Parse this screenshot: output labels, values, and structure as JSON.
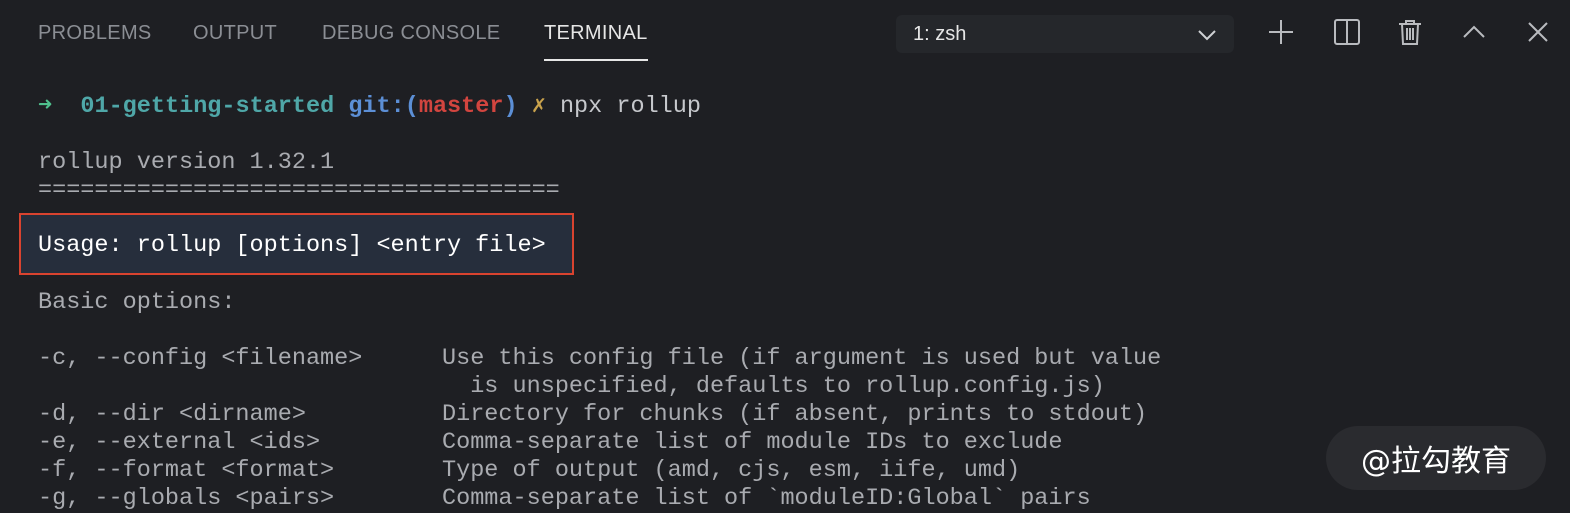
{
  "panel": {
    "tabs": [
      {
        "label": "PROBLEMS",
        "active": false
      },
      {
        "label": "OUTPUT",
        "active": false
      },
      {
        "label": "DEBUG CONSOLE",
        "active": false
      },
      {
        "label": "TERMINAL",
        "active": true
      }
    ],
    "shell_select": {
      "value": "1: zsh"
    },
    "toolbar_icons": [
      "plus-icon",
      "split-icon",
      "trash-icon",
      "chevron-up-icon",
      "close-icon"
    ]
  },
  "terminal": {
    "prompt": {
      "arrow": "➜",
      "dir": "01-getting-started",
      "git_label": "git:(",
      "branch": "master",
      "git_close": ")",
      "dirty_mark": "✗",
      "command": "npx rollup"
    },
    "version_line": "rollup version 1.32.1",
    "separator": "=====================================",
    "usage": "Usage: rollup [options] <entry file>",
    "basic_options_heading": "Basic options:",
    "options": [
      {
        "flag": "-c, --config <filename>",
        "desc": "Use this config file (if argument is used but value"
      },
      {
        "flag": "",
        "desc": "  is unspecified, defaults to rollup.config.js)"
      },
      {
        "flag": "-d, --dir <dirname>",
        "desc": "Directory for chunks (if absent, prints to stdout)"
      },
      {
        "flag": "-e, --external <ids>",
        "desc": "Comma-separate list of module IDs to exclude"
      },
      {
        "flag": "-f, --format <format>",
        "desc": "Type of output (amd, cjs, esm, iife, umd)"
      },
      {
        "flag": "-g, --globals <pairs>",
        "desc": "Comma-separate list of `moduleID:Global` pairs"
      }
    ]
  },
  "watermark": {
    "text": "@拉勾教育"
  },
  "colors": {
    "background": "#1e1f23",
    "highlight_border": "#d9432f",
    "prompt_arrow": "#4fc08d",
    "dir": "#4fa7a8",
    "git": "#5c8fd6",
    "branch": "#d2453f"
  }
}
